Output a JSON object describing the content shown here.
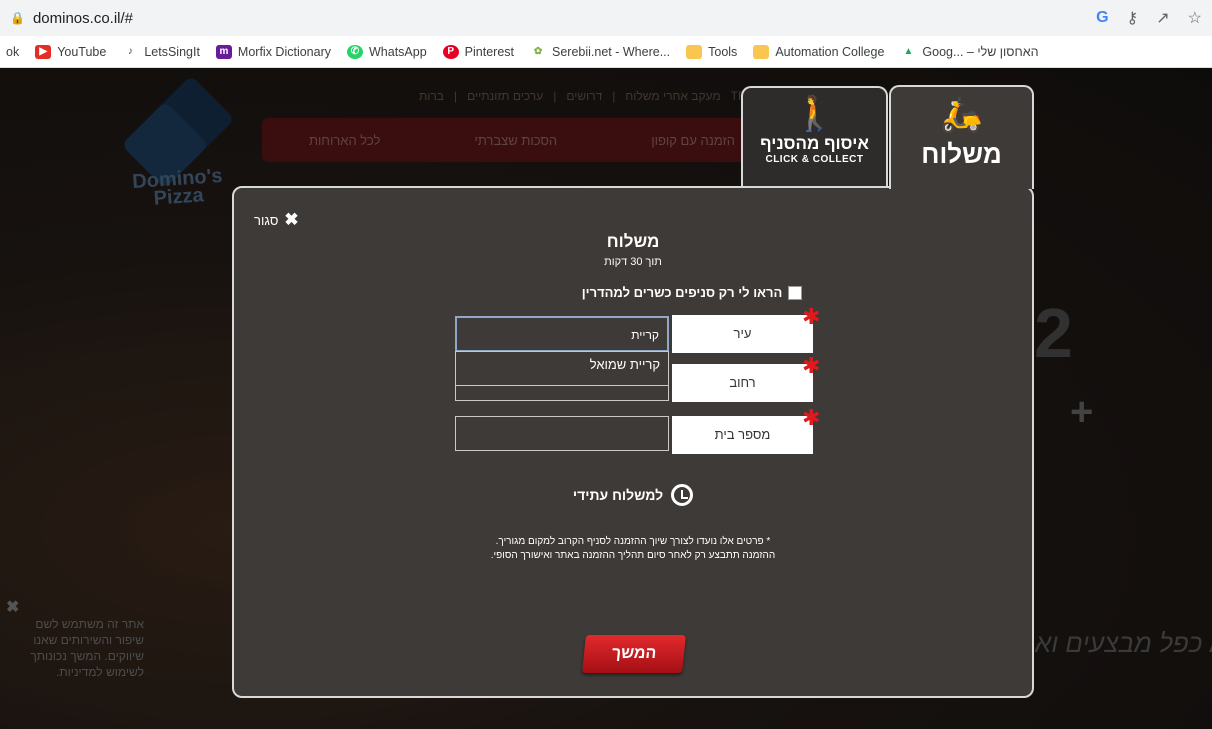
{
  "browser": {
    "url": "dominos.co.il/#",
    "bookmarks": [
      {
        "label": "ok",
        "icon": "facebook-icon"
      },
      {
        "label": "YouTube",
        "icon": "youtube-icon",
        "color": "#e52d27"
      },
      {
        "label": "LetsSingIt",
        "icon": "music-note-icon",
        "color": "#444444"
      },
      {
        "label": "Morfix Dictionary",
        "icon": "morfix-icon",
        "color": "#6a1b9a"
      },
      {
        "label": "WhatsApp",
        "icon": "whatsapp-icon",
        "color": "#25d366"
      },
      {
        "label": "Pinterest",
        "icon": "pinterest-icon",
        "color": "#e60023"
      },
      {
        "label": "Serebii.net - Where...",
        "icon": "serebii-icon",
        "color": "#7cb342"
      },
      {
        "label": "Tools",
        "icon": "folder-icon",
        "color": "#f9c74f"
      },
      {
        "label": "Automation College",
        "icon": "folder-icon",
        "color": "#f9c74f"
      },
      {
        "label": "Goog... – האחסון שלי",
        "icon": "google-drive-icon",
        "color": "#1fa463"
      }
    ]
  },
  "background": {
    "logo_text": "Domino's Pizza",
    "top_nav": [
      "TRACKER",
      "מעקב אחרי משלוח",
      "דרושים",
      "ערכים תזונתיים",
      "ברות"
    ],
    "red_bar": [
      "לכל הארוחות",
      "הסכות שצברתי",
      "הזמנה עם קופון"
    ],
    "cookie_text": "אתר זה משתמש לשם שיפור והשירותים שאנו שיווקים. המשך נכונותך לשימוש למדיניות.",
    "right_text": "ללא כפל מבצעים וא"
  },
  "tabs": {
    "delivery": {
      "title": "משלוח"
    },
    "pickup": {
      "title": "איסוף מהסניף",
      "subtitle": "CLICK & COLLECT"
    }
  },
  "modal": {
    "close_label": "סגור",
    "title": "משלוח",
    "subtitle": "תוך 30 דקות",
    "kosher_label": "הראו לי רק סניפים כשרים למהדרין",
    "city_label": "עיר",
    "city_value": "קריית",
    "street_label": "רחוב",
    "street_value": "קריית שמואל",
    "house_label": "מספר בית",
    "house_value": "",
    "future_label": "למשלוח עתידי",
    "note_line1": "* פרטים אלו נועדו לצורך שיוך ההזמנה לסניף הקרוב למקום מגוריך.",
    "note_line2": "ההזמנה תתבצע רק לאחר סיום תהליך ההזמנה באתר ואישורך הסופי.",
    "continue_label": "המשך"
  }
}
